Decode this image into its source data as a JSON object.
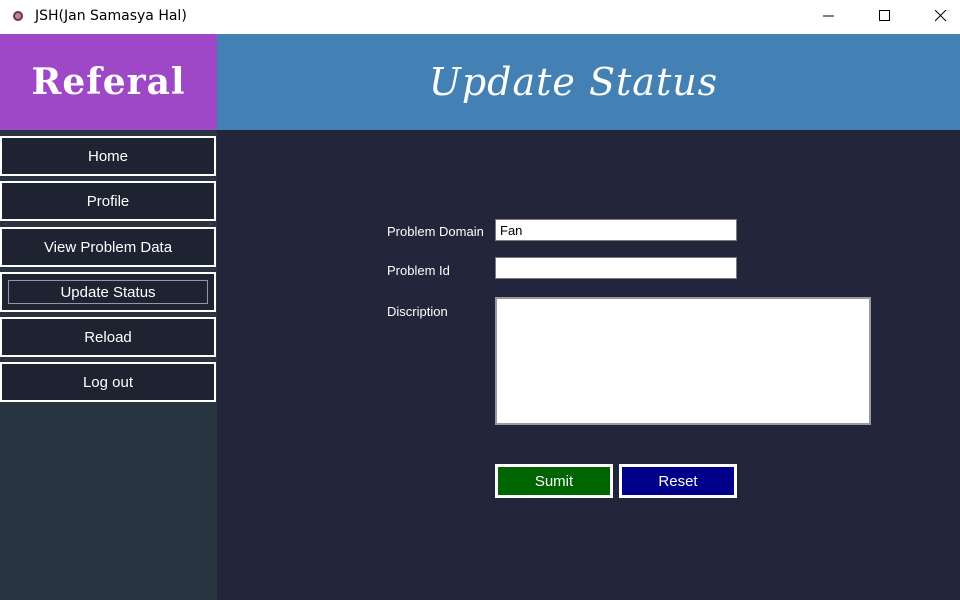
{
  "window": {
    "title": "JSH(Jan Samasya Hal)"
  },
  "logo": {
    "text": "Referal"
  },
  "header": {
    "title": "Update Status"
  },
  "sidebar": {
    "items": [
      {
        "label": "Home"
      },
      {
        "label": "Profile"
      },
      {
        "label": "View Problem Data"
      },
      {
        "label": "Update Status",
        "active": true
      },
      {
        "label": "Reload"
      },
      {
        "label": "Log out"
      }
    ]
  },
  "form": {
    "problem_domain_label": "Problem Domain",
    "problem_domain_value": "Fan",
    "problem_id_label": "Problem Id",
    "problem_id_value": "",
    "description_label": "Discription",
    "description_value": "",
    "submit_label": "Sumit",
    "reset_label": "Reset"
  },
  "colors": {
    "logo_bg": "#9f48c7",
    "header_bg": "#4380b3",
    "main_bg": "#23263a",
    "sidebar_bg": "#283540",
    "nav_btn_bg": "#1d2331",
    "submit_bg": "#006400",
    "reset_bg": "#00008b"
  }
}
